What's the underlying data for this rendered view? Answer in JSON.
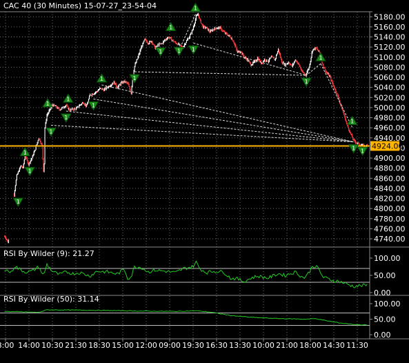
{
  "window": {
    "symbol": "CAC 40",
    "timeframe": "(30 Minutes)",
    "timestamp": "15-07-27_23-54-04"
  },
  "colors": {
    "background": "#000000",
    "grid": "#8c8c8c",
    "candle_up": "#ffffff",
    "candle_down": "#ff3c3c",
    "price_line": "#ffb400",
    "arrow_fill": "#1a8a1a",
    "arrow_down_fill": "#1f9e1f",
    "indicator_line": "#22cc22",
    "ref_line": "#c0c0c0",
    "trendline": "#dddddd"
  },
  "chart_data": [
    {
      "type": "candlestick",
      "title": "CAC 40 (30 Minutes) 15-07-27_23-54-04",
      "ylim": [
        4725,
        5190
      ],
      "y_ticks": [
        "5180.00",
        "5160.00",
        "5140.00",
        "5120.00",
        "5100.00",
        "5080.00",
        "5060.00",
        "5040.00",
        "5020.00",
        "5000.00",
        "4980.00",
        "4960.00",
        "4940.00",
        "4920.00",
        "4900.00",
        "4880.00",
        "4860.00",
        "4840.00",
        "4820.00",
        "4800.00",
        "4780.00",
        "4760.00",
        "4740.00"
      ],
      "y_tick_values": [
        5180,
        5160,
        5140,
        5120,
        5100,
        5080,
        5060,
        5040,
        5020,
        5000,
        4980,
        4960,
        4940,
        4920,
        4900,
        4880,
        4860,
        4840,
        4820,
        4800,
        4780,
        4760,
        4740
      ],
      "current_price": 4924.0,
      "current_price_label": "4924.00",
      "x_ticks": [
        "8:00",
        "14:00",
        "10:30",
        "21:30",
        "18:30",
        "15:00",
        "12:00",
        "09:00",
        "19:30",
        "16:30",
        "13:30",
        "10:00",
        "21:00",
        "18:00",
        "14:30",
        "11:30"
      ],
      "anchor_points": [
        [
          0,
          4745
        ],
        [
          3,
          4740
        ],
        [
          4,
          4735
        ],
        [
          5,
          4733
        ],
        [
          6,
          4737
        ],
        [
          14,
          4828
        ],
        [
          18,
          4865
        ],
        [
          24,
          4885
        ],
        [
          27,
          4880
        ],
        [
          30,
          4905
        ],
        [
          35,
          4888
        ],
        [
          40,
          4900
        ],
        [
          45,
          4918
        ],
        [
          50,
          4940
        ],
        [
          55,
          4925
        ],
        [
          57,
          4875
        ],
        [
          58,
          4890
        ],
        [
          59,
          4960
        ],
        [
          62,
          4985
        ],
        [
          66,
          4995
        ],
        [
          70,
          5005
        ],
        [
          75,
          5002
        ],
        [
          80,
          4996
        ],
        [
          85,
          5000
        ],
        [
          90,
          5005
        ],
        [
          95,
          4995
        ],
        [
          100,
          4997
        ],
        [
          105,
          4998
        ],
        [
          110,
          5005
        ],
        [
          115,
          5010
        ],
        [
          120,
          5003
        ],
        [
          125,
          5025
        ],
        [
          130,
          5028
        ],
        [
          135,
          5032
        ],
        [
          140,
          5038
        ],
        [
          145,
          5035
        ],
        [
          150,
          5040
        ],
        [
          155,
          5045
        ],
        [
          160,
          5050
        ],
        [
          165,
          5040
        ],
        [
          170,
          5048
        ],
        [
          175,
          5052
        ],
        [
          180,
          5048
        ],
        [
          185,
          5028
        ],
        [
          187,
          5060
        ],
        [
          190,
          5082
        ],
        [
          195,
          5100
        ],
        [
          200,
          5120
        ],
        [
          205,
          5135
        ],
        [
          210,
          5128
        ],
        [
          215,
          5132
        ],
        [
          220,
          5118
        ],
        [
          225,
          5125
        ],
        [
          230,
          5127
        ],
        [
          235,
          5135
        ],
        [
          240,
          5140
        ],
        [
          245,
          5134
        ],
        [
          250,
          5128
        ],
        [
          255,
          5125
        ],
        [
          260,
          5118
        ],
        [
          265,
          5130
        ],
        [
          270,
          5140
        ],
        [
          275,
          5155
        ],
        [
          280,
          5180
        ],
        [
          283,
          5185
        ],
        [
          285,
          5175
        ],
        [
          290,
          5160
        ],
        [
          295,
          5158
        ],
        [
          300,
          5150
        ],
        [
          305,
          5155
        ],
        [
          310,
          5158
        ],
        [
          315,
          5158
        ],
        [
          320,
          5150
        ],
        [
          325,
          5145
        ],
        [
          330,
          5140
        ],
        [
          335,
          5130
        ],
        [
          340,
          5110
        ],
        [
          345,
          5112
        ],
        [
          350,
          5100
        ],
        [
          355,
          5095
        ],
        [
          360,
          5085
        ],
        [
          365,
          5090
        ],
        [
          370,
          5098
        ],
        [
          375,
          5088
        ],
        [
          380,
          5095
        ],
        [
          385,
          5092
        ],
        [
          390,
          5100
        ],
        [
          395,
          5095
        ],
        [
          400,
          5115
        ],
        [
          405,
          5090
        ],
        [
          410,
          5085
        ],
        [
          415,
          5090
        ],
        [
          420,
          5082
        ],
        [
          425,
          5095
        ],
        [
          430,
          5085
        ],
        [
          435,
          5070
        ],
        [
          440,
          5065
        ],
        [
          445,
          5080
        ],
        [
          450,
          5115
        ],
        [
          455,
          5118
        ],
        [
          460,
          5110
        ],
        [
          465,
          5085
        ],
        [
          470,
          5070
        ],
        [
          475,
          5062
        ],
        [
          480,
          5045
        ],
        [
          485,
          5030
        ],
        [
          490,
          5010
        ],
        [
          495,
          4990
        ],
        [
          500,
          4968
        ],
        [
          505,
          4950
        ],
        [
          510,
          4935
        ],
        [
          515,
          4930
        ],
        [
          520,
          4926
        ],
        [
          525,
          4924
        ],
        [
          530,
          4924
        ]
      ],
      "fractal_up": [
        [
          20,
          4826
        ],
        [
          37,
          4887
        ],
        [
          68,
          4965
        ],
        [
          90,
          4993
        ],
        [
          130,
          5017
        ],
        [
          190,
          5071
        ],
        [
          228,
          5124
        ],
        [
          255,
          5125
        ],
        [
          276,
          5128
        ],
        [
          441,
          5064
        ],
        [
          510,
          4932
        ],
        [
          523,
          4927
        ]
      ],
      "fractal_down": [
        [
          30,
          4899
        ],
        [
          63,
          4996
        ],
        [
          93,
          5005
        ],
        [
          142,
          5045
        ],
        [
          243,
          5147
        ],
        [
          279,
          5185
        ],
        [
          462,
          5087
        ],
        [
          508,
          4961
        ]
      ],
      "trendlines": [
        [
          [
            68,
            4965
          ],
          [
            510,
            4932
          ]
        ],
        [
          [
            90,
            4993
          ],
          [
            510,
            4932
          ]
        ],
        [
          [
            130,
            5017
          ],
          [
            510,
            4932
          ]
        ],
        [
          [
            142,
            5045
          ],
          [
            510,
            4932
          ]
        ],
        [
          [
            190,
            5071
          ],
          [
            441,
            5064
          ]
        ],
        [
          [
            276,
            5128
          ],
          [
            441,
            5064
          ]
        ],
        [
          [
            279,
            5185
          ],
          [
            258,
            5123
          ]
        ],
        [
          [
            462,
            5087
          ],
          [
            441,
            5064
          ]
        ],
        [
          [
            462,
            5087
          ],
          [
            508,
            4961
          ]
        ]
      ]
    },
    {
      "type": "line",
      "title": "RSI By Wilder (9): 21.27",
      "value": 21.27,
      "ylim": [
        0,
        100
      ],
      "y_ticks": [
        "100.00",
        "50.00",
        "0.00"
      ],
      "y_tick_values": [
        100,
        50,
        0
      ],
      "reference_levels": [
        70,
        30
      ],
      "anchor_points": [
        [
          0,
          68
        ],
        [
          10,
          58
        ],
        [
          15,
          78
        ],
        [
          20,
          70
        ],
        [
          30,
          60
        ],
        [
          40,
          62
        ],
        [
          50,
          75
        ],
        [
          57,
          48
        ],
        [
          62,
          82
        ],
        [
          70,
          62
        ],
        [
          80,
          52
        ],
        [
          90,
          60
        ],
        [
          100,
          55
        ],
        [
          110,
          58
        ],
        [
          125,
          48
        ],
        [
          135,
          62
        ],
        [
          150,
          60
        ],
        [
          165,
          54
        ],
        [
          175,
          68
        ],
        [
          180,
          42
        ],
        [
          185,
          45
        ],
        [
          190,
          75
        ],
        [
          200,
          73
        ],
        [
          210,
          60
        ],
        [
          220,
          65
        ],
        [
          235,
          62
        ],
        [
          250,
          58
        ],
        [
          262,
          70
        ],
        [
          275,
          75
        ],
        [
          280,
          88
        ],
        [
          285,
          70
        ],
        [
          295,
          58
        ],
        [
          305,
          62
        ],
        [
          320,
          60
        ],
        [
          330,
          42
        ],
        [
          340,
          40
        ],
        [
          350,
          32
        ],
        [
          360,
          42
        ],
        [
          370,
          48
        ],
        [
          385,
          42
        ],
        [
          400,
          55
        ],
        [
          410,
          50
        ],
        [
          425,
          60
        ],
        [
          437,
          42
        ],
        [
          445,
          58
        ],
        [
          450,
          78
        ],
        [
          458,
          72
        ],
        [
          465,
          45
        ],
        [
          480,
          35
        ],
        [
          490,
          32
        ],
        [
          500,
          25
        ],
        [
          510,
          18
        ],
        [
          520,
          20
        ],
        [
          530,
          21.27
        ]
      ]
    },
    {
      "type": "line",
      "title": "RSI By Wilder (50): 31.14",
      "value": 31.14,
      "ylim": [
        0,
        100
      ],
      "y_ticks": [
        "100.00",
        "50.00",
        "0.00"
      ],
      "y_tick_values": [
        100,
        50,
        0
      ],
      "reference_levels": [
        70,
        30
      ],
      "anchor_points": [
        [
          0,
          75
        ],
        [
          50,
          72
        ],
        [
          62,
          80
        ],
        [
          120,
          79
        ],
        [
          180,
          77
        ],
        [
          200,
          76
        ],
        [
          250,
          75
        ],
        [
          280,
          77
        ],
        [
          300,
          73
        ],
        [
          330,
          62
        ],
        [
          360,
          56
        ],
        [
          400,
          52
        ],
        [
          440,
          50
        ],
        [
          455,
          52
        ],
        [
          470,
          45
        ],
        [
          490,
          38
        ],
        [
          510,
          33
        ],
        [
          530,
          31.14
        ]
      ]
    }
  ]
}
